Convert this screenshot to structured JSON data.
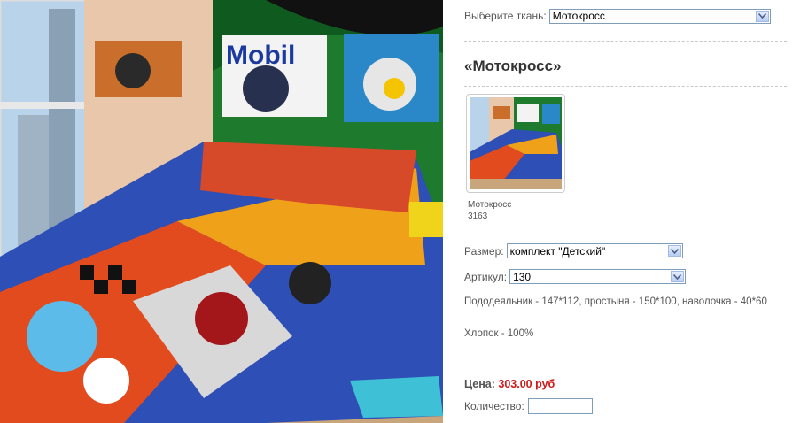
{
  "fabric": {
    "label": "Выберите ткань:",
    "selected": "Мотокросс"
  },
  "product": {
    "title": "«Мотокросс»",
    "thumb_name": "Мотокросс",
    "thumb_code": "3163",
    "poster_text": "Mobil"
  },
  "size": {
    "label": "Размер:",
    "selected": "комплект \"Детский\""
  },
  "article": {
    "label": "Артикул:",
    "selected": "130"
  },
  "description": "Пододеяльник - 147*112, простыня - 150*100, наволочка - 40*60",
  "material": "Хлопок - 100%",
  "price": {
    "label": "Цена:",
    "value": "303.00 руб"
  },
  "quantity": {
    "label": "Количество:",
    "value": ""
  },
  "colors": {
    "price": "#cc1a1a",
    "border": "#7f9db9",
    "wall_green": "#1e7a2c"
  }
}
